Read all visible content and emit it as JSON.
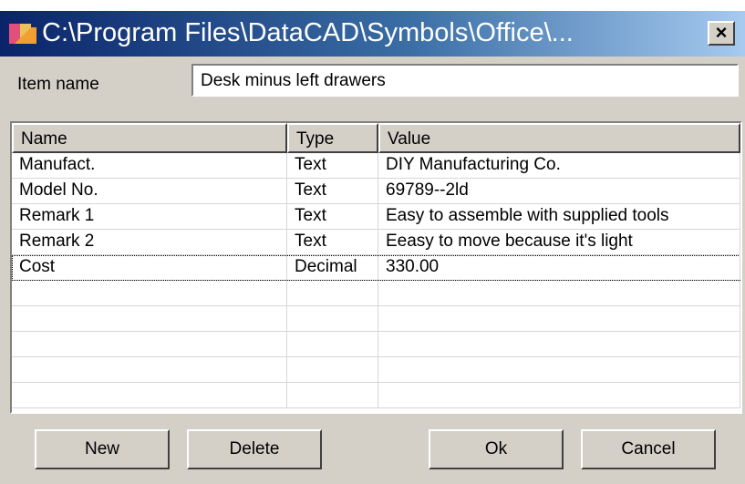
{
  "window": {
    "title": "C:\\Program Files\\DataCAD\\Symbols\\Office\\...",
    "close_glyph": "×",
    "icon": "app-icon"
  },
  "item": {
    "label": "Item name",
    "value": "Desk minus left drawers"
  },
  "table": {
    "columns": [
      "Name",
      "Type",
      "Value"
    ],
    "rows": [
      [
        "Manufact.",
        "Text",
        "DIY Manufacturing Co."
      ],
      [
        "Model No.",
        "Text",
        "69789--2ld"
      ],
      [
        "Remark 1",
        "Text",
        "Easy to assemble with supplied tools"
      ],
      [
        "Remark 2",
        "Text",
        "Eeasy to move because it's light"
      ],
      [
        "Cost",
        "Decimal",
        "330.00"
      ],
      [
        "",
        "",
        ""
      ],
      [
        "",
        "",
        ""
      ],
      [
        "",
        "",
        ""
      ],
      [
        "",
        "",
        ""
      ],
      [
        "",
        "",
        ""
      ]
    ],
    "selected_row": 4
  },
  "buttons": {
    "new": "New",
    "delete": "Delete",
    "ok": "Ok",
    "cancel": "Cancel"
  }
}
